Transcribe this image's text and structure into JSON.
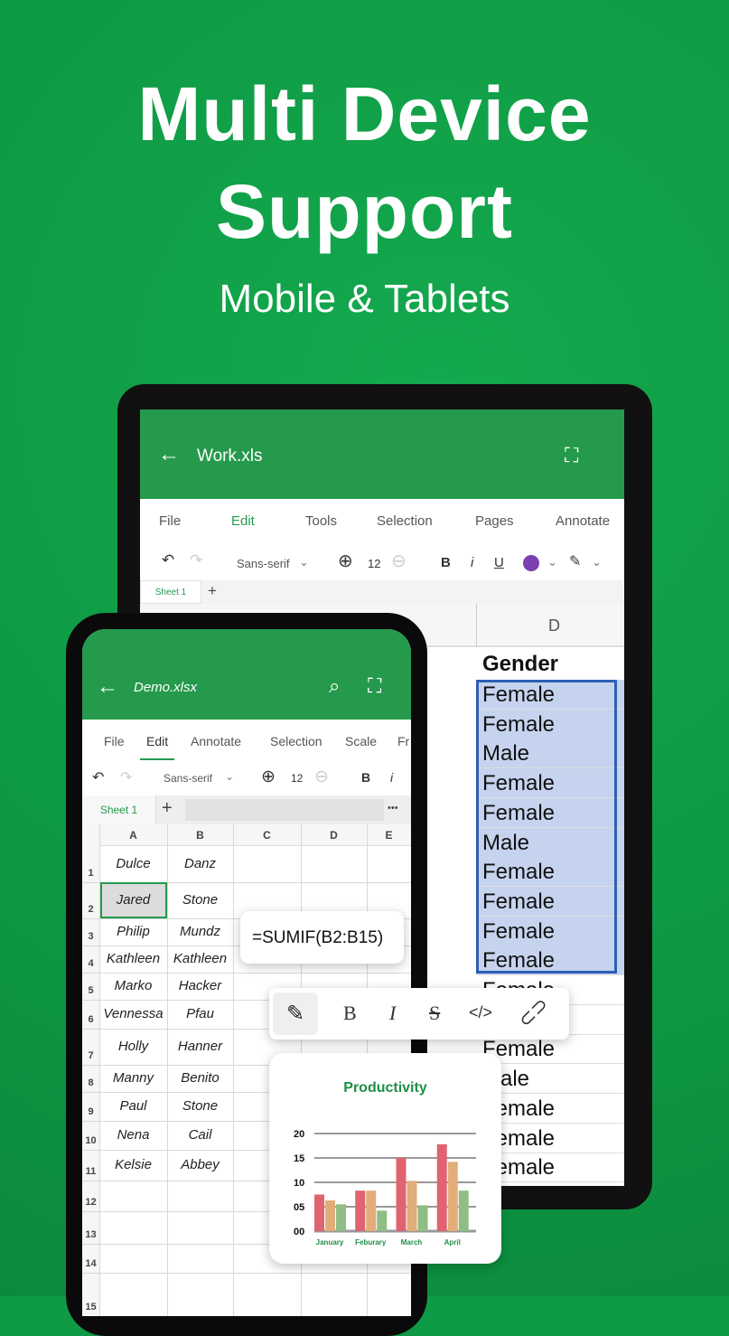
{
  "hero": {
    "line1": "Multi Device",
    "line2": "Support",
    "subtitle": "Mobile & Tablets"
  },
  "tablet": {
    "title": "Work.xls",
    "menu": [
      "File",
      "Edit",
      "Tools",
      "Selection",
      "Pages",
      "Annotate"
    ],
    "active_menu": "Edit",
    "font": "Sans-serif",
    "font_size": "12",
    "toolbar": {
      "bold": "B",
      "italic": "i",
      "underline": "U"
    },
    "text_color": "#7b3fb0",
    "sheet_tab": "Sheet 1",
    "add_sheet": "+",
    "column_header": "D",
    "column_title": "Gender",
    "gender_values": [
      "Female",
      "Female",
      "Male",
      "Female",
      "Female",
      "Male",
      "Female",
      "Female",
      "Female",
      "Female",
      "Female",
      "Female",
      "Female",
      "Male",
      "Female",
      "Female",
      "Female"
    ]
  },
  "phone": {
    "title": "Demo.xlsx",
    "menu": [
      "File",
      "Edit",
      "Annotate",
      "Selection",
      "Scale",
      "Fr"
    ],
    "active_menu": "Edit",
    "font": "Sans-serif",
    "font_size": "12",
    "toolbar": {
      "bold": "B",
      "italic": "i"
    },
    "sheet_tab": "Sheet 1",
    "add_sheet": "+",
    "more": "•••",
    "columns": [
      "A",
      "B",
      "C",
      "D",
      "E"
    ],
    "rows": [
      {
        "n": "1",
        "a": "Dulce",
        "b": "Danz"
      },
      {
        "n": "2",
        "a": "Jared",
        "b": "Stone"
      },
      {
        "n": "3",
        "a": "Philip",
        "b": "Mundz"
      },
      {
        "n": "4",
        "a": "Kathleen",
        "b": "Kathleen"
      },
      {
        "n": "5",
        "a": "Marko",
        "b": "Hacker"
      },
      {
        "n": "6",
        "a": "Vennessa",
        "b": "Pfau"
      },
      {
        "n": "7",
        "a": "Holly",
        "b": "Hanner"
      },
      {
        "n": "8",
        "a": "Manny",
        "b": "Benito"
      },
      {
        "n": "9",
        "a": "Paul",
        "b": "Stone"
      },
      {
        "n": "10",
        "a": "Nena",
        "b": "Cail"
      },
      {
        "n": "11",
        "a": "Kelsie",
        "b": "Abbey"
      },
      {
        "n": "12",
        "a": "",
        "b": ""
      },
      {
        "n": "13",
        "a": "",
        "b": ""
      },
      {
        "n": "14",
        "a": "",
        "b": ""
      },
      {
        "n": "15",
        "a": "",
        "b": ""
      }
    ]
  },
  "formula": "=SUMIF(B2:B15)",
  "format_bar": {
    "bold": "B",
    "italic": "I",
    "strike": "S",
    "code": "</>"
  },
  "chart_data": {
    "type": "bar",
    "title": "Productivity",
    "categories": [
      "January",
      "Feburary",
      "March",
      "April"
    ],
    "series": [
      {
        "values": [
          7.5,
          8.3,
          15,
          17.8
        ],
        "color": "#e06470"
      },
      {
        "values": [
          6.3,
          8.3,
          10.3,
          14.2
        ],
        "color": "#e2ad7a"
      },
      {
        "values": [
          5.5,
          4.2,
          5.3,
          8.3
        ],
        "color": "#8fbd83"
      }
    ],
    "yticks": [
      "00",
      "05",
      "10",
      "15",
      "20"
    ],
    "ylim": [
      0,
      20
    ],
    "grid": true
  },
  "colors": {
    "brand": "#259a4c",
    "selection": "#c5d3ee",
    "selection_border": "#2c5fb3"
  }
}
